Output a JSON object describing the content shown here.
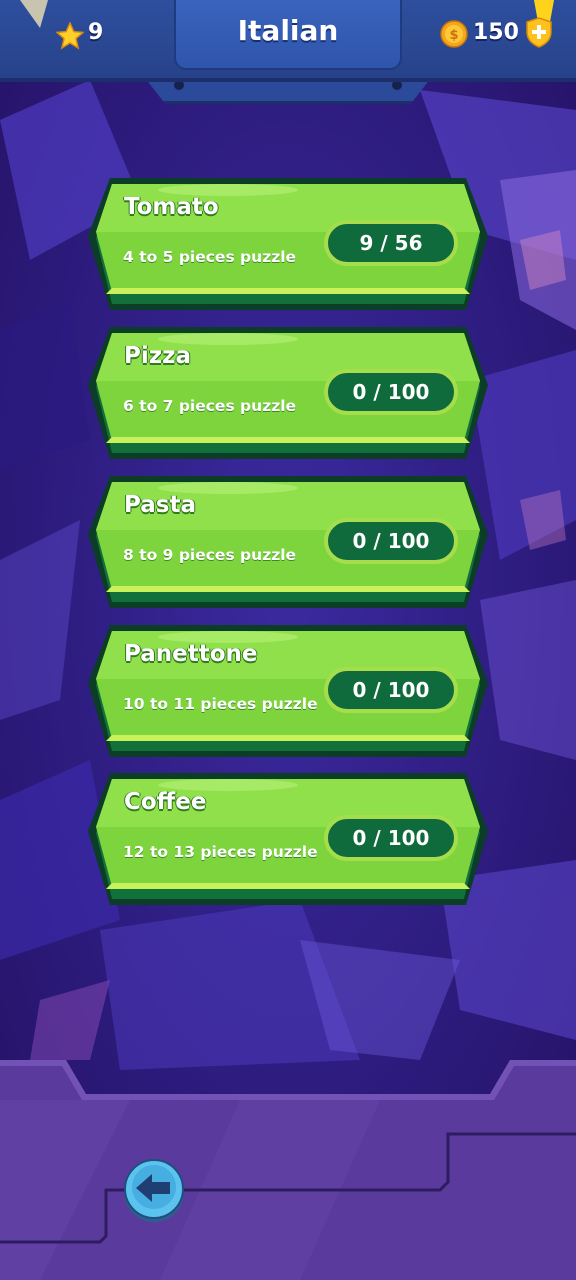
{
  "header": {
    "title": "Italian",
    "stars": "9",
    "coins": "150"
  },
  "levels": [
    {
      "name": "Tomato",
      "subtitle": "4 to 5 pieces puzzle",
      "progress": "9 / 56"
    },
    {
      "name": "Pizza",
      "subtitle": "6 to 7 pieces puzzle",
      "progress": "0 / 100"
    },
    {
      "name": "Pasta",
      "subtitle": "8 to 9 pieces puzzle",
      "progress": "0 / 100"
    },
    {
      "name": "Panettone",
      "subtitle": "10 to 11 pieces puzzle",
      "progress": "0 / 100"
    },
    {
      "name": "Coffee",
      "subtitle": "12 to 13 pieces puzzle",
      "progress": "0 / 100"
    }
  ],
  "icons": {
    "star": "star-icon",
    "coin": "coin-icon",
    "shield": "shield-plus-icon",
    "back": "arrow-left-icon"
  },
  "colors": {
    "card_green": "#7ed43c",
    "card_dark": "#0d5a2f",
    "pill": "#0f6b3c",
    "topbar": "#2e4f9e",
    "bottom_panel": "#5a3a9c"
  }
}
